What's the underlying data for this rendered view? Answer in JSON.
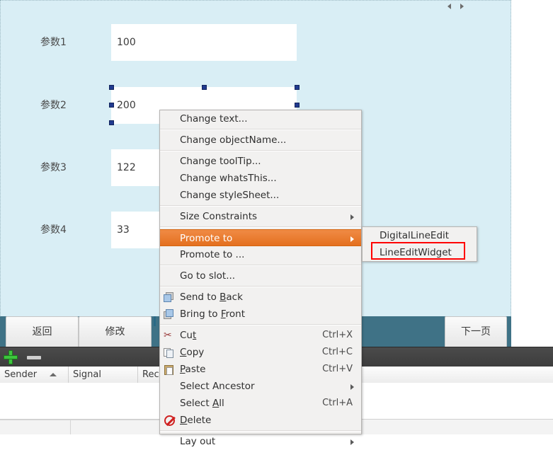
{
  "form": {
    "rows": [
      {
        "label": "参数1",
        "value": "100"
      },
      {
        "label": "参数2",
        "value": "200"
      },
      {
        "label": "参数3",
        "value": "122"
      },
      {
        "label": "参数4",
        "value": "33"
      }
    ],
    "buttons": [
      {
        "label": "返回"
      },
      {
        "label": "修改"
      },
      {
        "label": "下一页"
      }
    ],
    "background_color": "#d9eef5",
    "spacer_color": "#3f7286"
  },
  "scroll_arrows": {
    "left_icon": "triangle-left-icon",
    "right_icon": "triangle-right-icon"
  },
  "toolbar": {
    "add_icon": "plus-icon",
    "remove_icon": "minus-icon"
  },
  "signal_table": {
    "columns": [
      "Sender",
      "Signal",
      "Rec"
    ],
    "sort_indicator": "sort-ascending-icon",
    "rows": []
  },
  "context_menu": {
    "items": [
      {
        "label": "Change text...",
        "type": "item"
      },
      {
        "type": "separator"
      },
      {
        "label": "Change objectName...",
        "type": "item"
      },
      {
        "type": "separator"
      },
      {
        "label": "Change toolTip...",
        "type": "item"
      },
      {
        "label": "Change whatsThis...",
        "type": "item"
      },
      {
        "label": "Change styleSheet...",
        "type": "item"
      },
      {
        "type": "separator"
      },
      {
        "label": "Size Constraints",
        "type": "submenu"
      },
      {
        "type": "separator"
      },
      {
        "label": "Promote to",
        "type": "submenu",
        "highlighted": true
      },
      {
        "label": "Promote to ...",
        "type": "item"
      },
      {
        "type": "separator"
      },
      {
        "label": "Go to slot...",
        "type": "item"
      },
      {
        "type": "separator"
      },
      {
        "label": "Send to Back",
        "type": "item",
        "icon": "send-to-back-icon",
        "mnemonic": "B"
      },
      {
        "label": "Bring to Front",
        "type": "item",
        "icon": "bring-to-front-icon",
        "mnemonic": "F"
      },
      {
        "type": "separator"
      },
      {
        "label": "Cut",
        "type": "item",
        "icon": "scissors-icon",
        "shortcut": "Ctrl+X",
        "mnemonic": "t"
      },
      {
        "label": "Copy",
        "type": "item",
        "icon": "copy-icon",
        "shortcut": "Ctrl+C",
        "mnemonic": "C"
      },
      {
        "label": "Paste",
        "type": "item",
        "icon": "clipboard-icon",
        "shortcut": "Ctrl+V",
        "mnemonic": "P"
      },
      {
        "label": "Select Ancestor",
        "type": "submenu"
      },
      {
        "label": "Select All",
        "type": "item",
        "shortcut": "Ctrl+A",
        "mnemonic": "A"
      },
      {
        "label": "Delete",
        "type": "item",
        "icon": "delete-icon",
        "mnemonic": "D"
      },
      {
        "type": "separator"
      },
      {
        "label": "Lay out",
        "type": "submenu"
      }
    ],
    "labels": {
      "change_text": "Change text...",
      "change_object_name": "Change objectName...",
      "change_tooltip": "Change toolTip...",
      "change_whats_this": "Change whatsThis...",
      "change_stylesheet": "Change styleSheet...",
      "size_constraints": "Size Constraints",
      "promote_to": "Promote to",
      "promote_to_dialog": "Promote to ...",
      "go_to_slot": "Go to slot...",
      "send_to_back": "Send to ",
      "send_to_back_m": "B",
      "send_to_back_rest": "ack",
      "bring_to_front": "Bring to ",
      "bring_to_front_m": "F",
      "bring_to_front_rest": "ront",
      "cut": "Cu",
      "cut_m": "t",
      "copy_m": "C",
      "copy_rest": "opy",
      "paste_m": "P",
      "paste_rest": "aste",
      "select_ancestor": "Select Ancestor",
      "select_all": "Select ",
      "select_all_m": "A",
      "select_all_rest": "ll",
      "delete_m": "D",
      "delete_rest": "elete",
      "lay_out": "Lay out"
    },
    "shortcuts": {
      "cut": "Ctrl+X",
      "copy": "Ctrl+C",
      "paste": "Ctrl+V",
      "select_all": "Ctrl+A"
    },
    "highlight_color": "#e4701f"
  },
  "promote_submenu": {
    "items": [
      {
        "label": "DigitalLineEdit"
      },
      {
        "label": "LineEditWidget",
        "annotated": true
      }
    ],
    "annotation_color": "#ff0000"
  }
}
